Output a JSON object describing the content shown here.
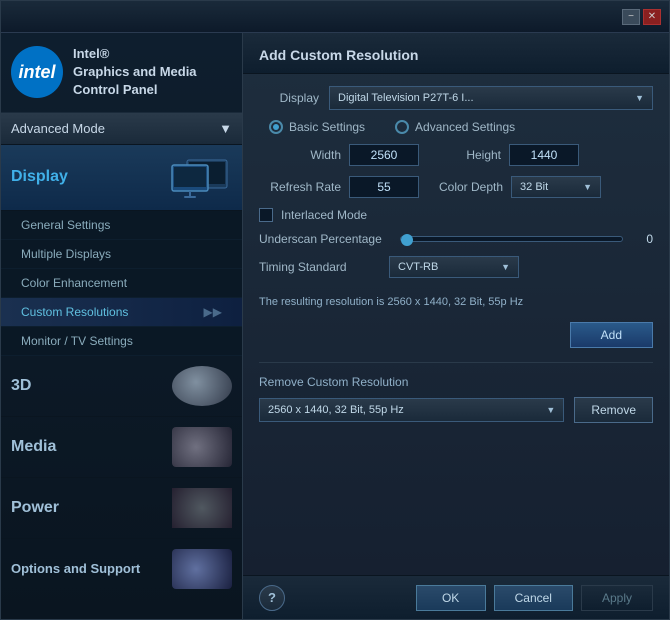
{
  "window": {
    "minimize_label": "−",
    "close_label": "✕"
  },
  "sidebar": {
    "logo_text": "intel",
    "app_title": "Intel®\nGraphics and Media\nControl Panel",
    "mode_label": "Advanced Mode",
    "nav_items": [
      {
        "id": "display",
        "label": "Display",
        "active": true,
        "sub_items": [
          {
            "id": "general-settings",
            "label": "General Settings",
            "active": false
          },
          {
            "id": "multiple-displays",
            "label": "Multiple Displays",
            "active": false
          },
          {
            "id": "color-enhancement",
            "label": "Color Enhancement",
            "active": false
          },
          {
            "id": "custom-resolutions",
            "label": "Custom Resolutions",
            "active": true,
            "has_arrow": true
          },
          {
            "id": "monitor-settings",
            "label": "Monitor / TV Settings",
            "active": false
          }
        ]
      },
      {
        "id": "3d",
        "label": "3D",
        "active": false
      },
      {
        "id": "media",
        "label": "Media",
        "active": false
      },
      {
        "id": "power",
        "label": "Power",
        "active": false
      },
      {
        "id": "options-support",
        "label": "Options and Support",
        "active": false
      }
    ]
  },
  "panel": {
    "title": "Add Custom Resolution",
    "display_label": "Display",
    "display_value": "Digital Television P27T-6 I...",
    "basic_settings_label": "Basic Settings",
    "advanced_settings_label": "Advanced Settings",
    "width_label": "Width",
    "width_value": "2560",
    "height_label": "Height",
    "height_value": "1440",
    "refresh_rate_label": "Refresh Rate",
    "refresh_rate_value": "55",
    "color_depth_label": "Color Depth",
    "color_depth_value": "32 Bit",
    "interlaced_label": "Interlaced Mode",
    "underscan_label": "Underscan Percentage",
    "underscan_value": "0",
    "timing_label": "Timing Standard",
    "timing_value": "CVT-RB",
    "result_text": "The resulting resolution is 2560 x 1440, 32 Bit, 55p Hz",
    "add_button_label": "Add",
    "remove_section_title": "Remove Custom Resolution",
    "remove_resolution_value": "2560 x 1440, 32 Bit, 55p Hz",
    "remove_button_label": "Remove"
  },
  "bottom_bar": {
    "help_label": "?",
    "ok_label": "OK",
    "cancel_label": "Cancel",
    "apply_label": "Apply"
  }
}
